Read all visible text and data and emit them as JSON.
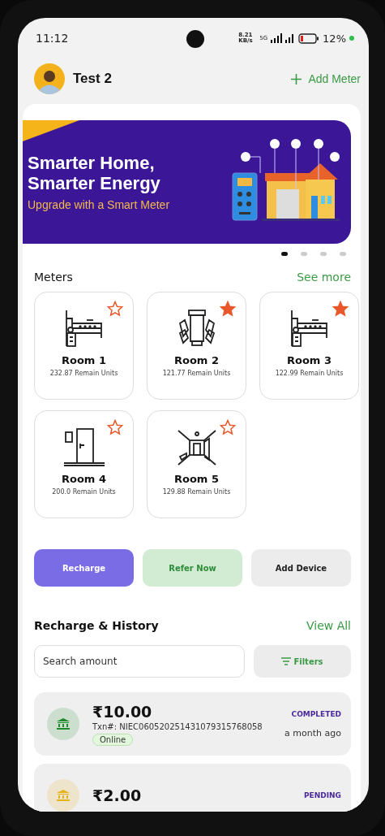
{
  "status_bar": {
    "time": "11:12",
    "speed": "8.21 KB/s",
    "network": "5G",
    "battery": "12%"
  },
  "header": {
    "user_name": "Test 2",
    "add_button": "Add Meter"
  },
  "banner": {
    "title": "Smarter Home, Smarter Energy",
    "subtitle": "Upgrade with a Smart Meter"
  },
  "carousel_dots": [
    {
      "selected": true
    },
    {
      "selected": false
    },
    {
      "selected": false
    },
    {
      "selected": false
    }
  ],
  "meters_section": {
    "title": "Meters",
    "link": "See more"
  },
  "meters": [
    {
      "kind": "bed",
      "name": "Room 1",
      "units": "232.87 Remain Units",
      "favorite": false
    },
    {
      "kind": "dining",
      "name": "Room 2",
      "units": "121.77 Remain Units",
      "favorite": true
    },
    {
      "kind": "bed",
      "name": "Room 3",
      "units": "122.99 Remain Units",
      "favorite": true
    },
    {
      "kind": "door",
      "name": "Room 4",
      "units": "200.0 Remain Units",
      "favorite": false
    },
    {
      "kind": "hall",
      "name": "Room 5",
      "units": "129.88 Remain Units",
      "favorite": false
    }
  ],
  "actions": [
    {
      "kind": "primary",
      "label": "Recharge"
    },
    {
      "kind": "success",
      "label": "Refer Now"
    },
    {
      "kind": "neutral",
      "label": "Add Device"
    }
  ],
  "history": {
    "title": "Recharge & History",
    "link": "View All",
    "search": {
      "placeholder": "Search amount"
    },
    "filter_button": "Filters"
  },
  "transactions": [
    {
      "amount": "₹10.00",
      "txn": "Txn#: NIEC060520251431079315768058",
      "method": "Online",
      "status": "COMPLETED",
      "color": "#1e8a2b",
      "time": "a month ago"
    },
    {
      "amount": "₹2.00",
      "status": "PENDING",
      "color": "#e6b21a"
    }
  ]
}
